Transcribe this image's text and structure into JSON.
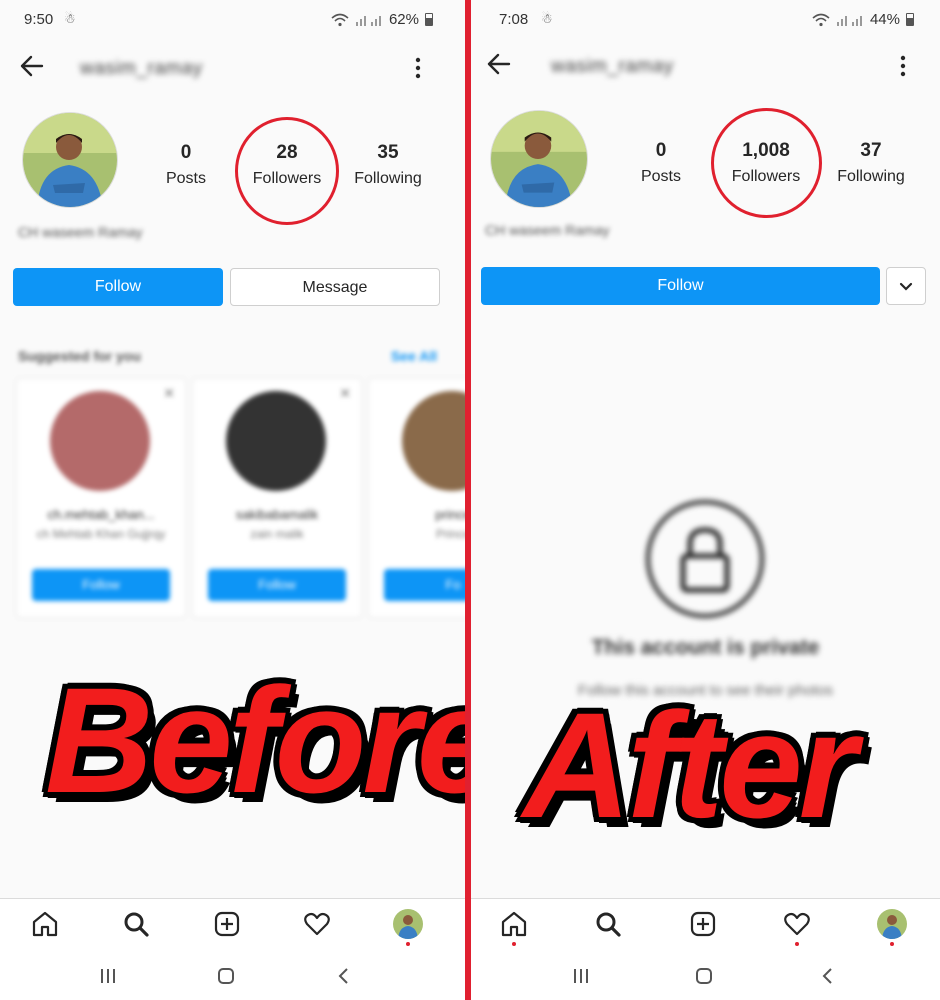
{
  "before": {
    "status": {
      "time": "9:50",
      "battery": "62%"
    },
    "username": "wasim_ramay",
    "stats": [
      {
        "value": "0",
        "label": "Posts"
      },
      {
        "value": "28",
        "label": "Followers"
      },
      {
        "value": "35",
        "label": "Following"
      }
    ],
    "bio_name": "CH waseem Ramay",
    "buttons": {
      "follow": "Follow",
      "message": "Message"
    },
    "suggested": {
      "heading": "Suggested for you",
      "see_all": "See All",
      "cards": [
        {
          "name": "ch.mehtab_khan...",
          "sub": "ch Mehtab Khan Gujjrqy",
          "button": "Follow"
        },
        {
          "name": "sakibabamalik",
          "sub": "zain malik",
          "button": "Follow"
        },
        {
          "name": "prince",
          "sub": "Prince",
          "button": "Fo"
        }
      ]
    },
    "overlay_word": "Before"
  },
  "after": {
    "status": {
      "time": "7:08",
      "battery": "44%"
    },
    "username": "wasim_ramay",
    "stats": [
      {
        "value": "0",
        "label": "Posts"
      },
      {
        "value": "1,008",
        "label": "Followers"
      },
      {
        "value": "37",
        "label": "Following"
      }
    ],
    "bio_name": "CH waseem Ramay",
    "buttons": {
      "follow": "Follow"
    },
    "private": {
      "title": "This account is private",
      "subtitle": "Follow this account to see their photos"
    },
    "overlay_word": "After"
  },
  "colors": {
    "accent": "#0d95f6",
    "highlight_circle": "#e0202e",
    "divider": "#e02030",
    "overlay_text": "#f21d1d"
  },
  "icons": [
    "arrow-left-icon",
    "more-vertical-icon",
    "home-icon",
    "search-icon",
    "add-post-icon",
    "heart-icon",
    "profile-avatar-icon",
    "recent-apps-icon",
    "home-button-icon",
    "back-chevron-icon",
    "lock-icon",
    "chevron-down-icon"
  ]
}
